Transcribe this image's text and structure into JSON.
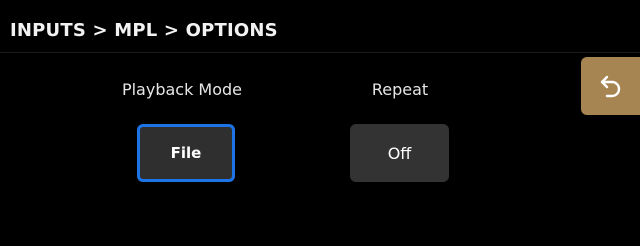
{
  "header": {
    "breadcrumb": "INPUTS > MPL > OPTIONS"
  },
  "options": {
    "playback_mode": {
      "label": "Playback Mode",
      "value": "File",
      "selected": true
    },
    "repeat": {
      "label": "Repeat",
      "value": "Off",
      "selected": false
    }
  },
  "back_button": {
    "icon": "undo-arrow-icon"
  },
  "colors": {
    "background": "#000000",
    "button_bg": "#333333",
    "selected_border": "#1d74e6",
    "back_button_bg": "#a78552"
  }
}
